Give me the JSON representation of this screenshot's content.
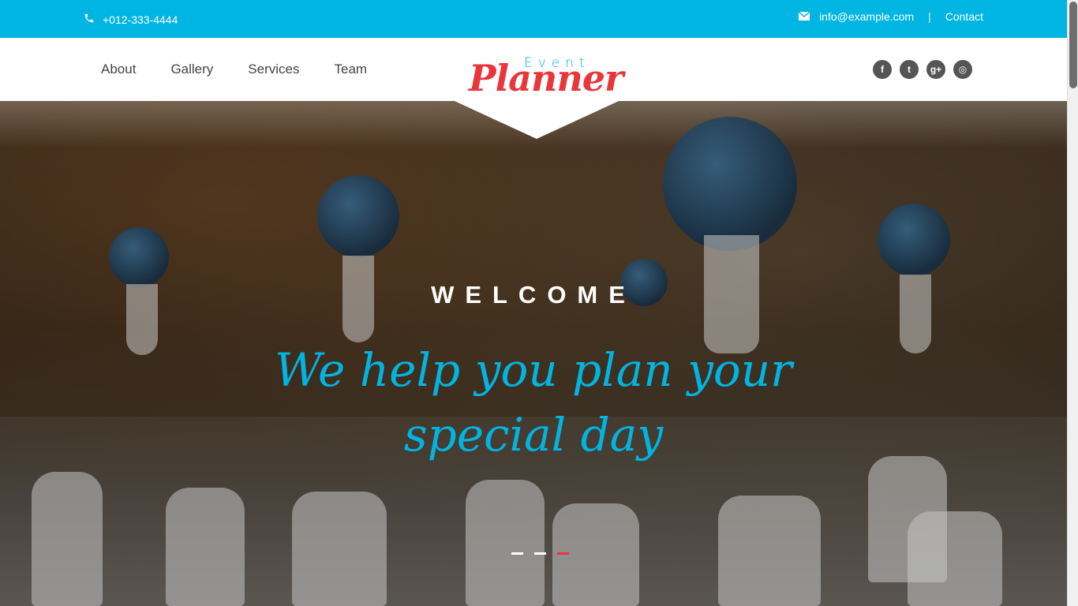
{
  "topbar": {
    "phone": "+012-333-4444",
    "email": "info@example.com",
    "separator": "|",
    "contact": "Contact"
  },
  "nav": {
    "links": [
      "About",
      "Gallery",
      "Services",
      "Team"
    ]
  },
  "logo": {
    "event": "Event",
    "planner": "Planner"
  },
  "social": {
    "facebook": "f",
    "twitter": "t",
    "google_plus": "g+",
    "dribbble": "◎"
  },
  "hero": {
    "welcome": "WELCOME",
    "tagline": "We help you plan your special day",
    "slides_count": 3,
    "active_slide": 3
  },
  "colors": {
    "accent": "#00b5e2",
    "brand": "#e8363b"
  }
}
